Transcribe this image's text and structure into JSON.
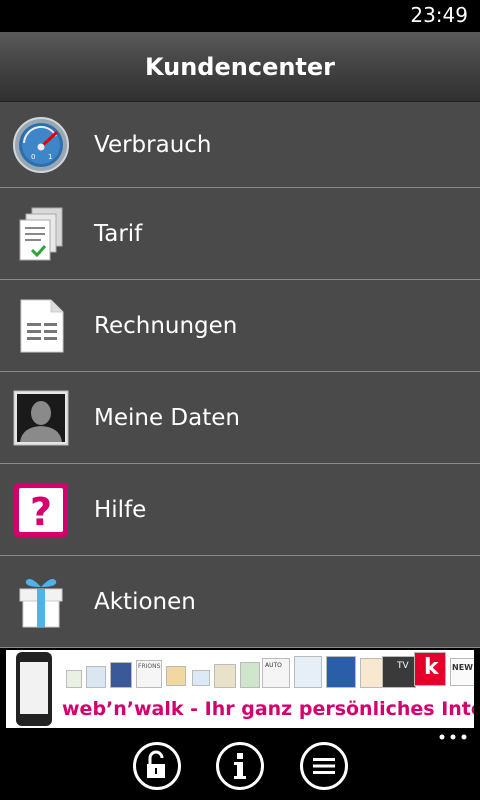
{
  "status_bar": {
    "time": "23:49"
  },
  "header": {
    "title": "Kundencenter"
  },
  "menu": {
    "items": [
      {
        "label": "Verbrauch",
        "icon": "speedometer-icon"
      },
      {
        "label": "Tarif",
        "icon": "tariff-documents-icon"
      },
      {
        "label": "Rechnungen",
        "icon": "invoice-document-icon"
      },
      {
        "label": "Meine Daten",
        "icon": "profile-silhouette-icon"
      },
      {
        "label": "Hilfe",
        "icon": "help-question-icon"
      },
      {
        "label": "Aktionen",
        "icon": "gift-icon"
      }
    ]
  },
  "ad_banner": {
    "text": "web’n’walk - Ihr ganz persönliches Internet.",
    "tiles": [
      "FRIONS",
      "AUTO",
      "TV",
      "k",
      "NEW"
    ],
    "accent_color": "#d4006e"
  },
  "app_bar": {
    "buttons": [
      {
        "name": "lock-button",
        "icon": "unlock-icon"
      },
      {
        "name": "info-button",
        "icon": "info-icon"
      },
      {
        "name": "menu-button",
        "icon": "menu-list-icon"
      }
    ],
    "more_icon": "ellipsis-icon"
  },
  "colors": {
    "magenta": "#d4006e",
    "menu_bg": "#4a4a4a",
    "header_bg": "#474747"
  }
}
